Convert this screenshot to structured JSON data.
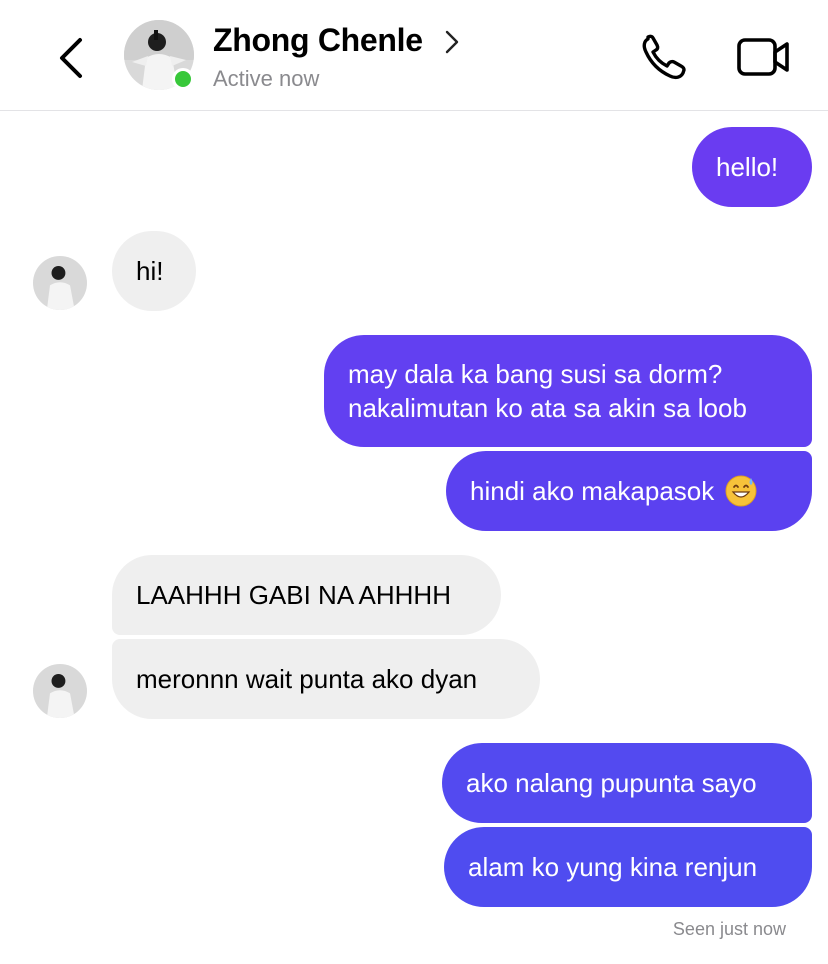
{
  "header": {
    "contact_name": "Zhong Chenle",
    "status": "Active now"
  },
  "colors": {
    "bubble_out_1": "#6a3cf1",
    "bubble_out_2": "#5b41f0",
    "bubble_out_3": "#4f4cf0",
    "bubble_in": "#efefef",
    "online": "#38c83a"
  },
  "messages": [
    {
      "dir": "out",
      "text": "hello!"
    },
    {
      "dir": "in",
      "text": "hi!"
    },
    {
      "dir": "out",
      "lines": [
        "may dala ka bang susi sa dorm?",
        "nakalimutan ko ata sa akin sa loob"
      ]
    },
    {
      "dir": "out",
      "text": "hindi ako makapasok",
      "emoji": "grinning-sweat-emoji"
    },
    {
      "dir": "in",
      "text": "LAAHHH GABI NA AHHHH"
    },
    {
      "dir": "in",
      "text": "meronnn wait punta ako dyan"
    },
    {
      "dir": "out",
      "text": "ako nalang pupunta sayo"
    },
    {
      "dir": "out",
      "text": "alam ko yung kina renjun"
    }
  ],
  "receipt": "Seen just now"
}
